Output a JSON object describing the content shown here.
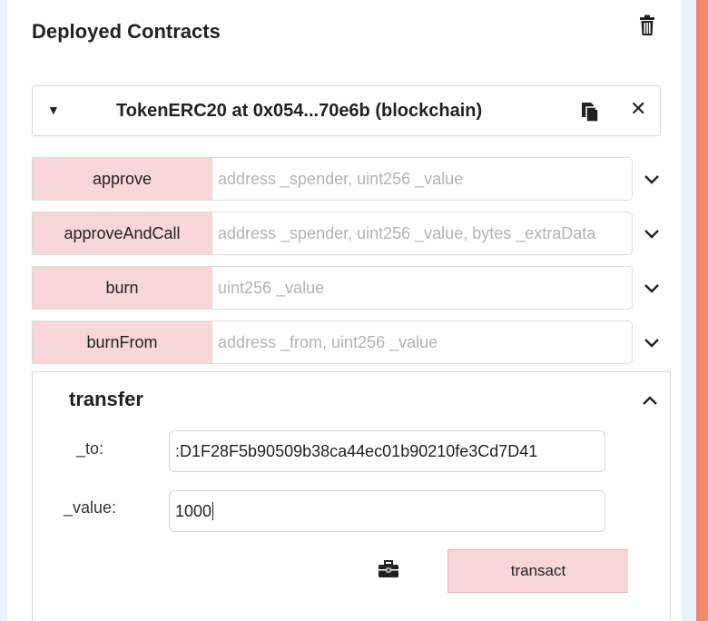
{
  "section": {
    "title": "Deployed Contracts"
  },
  "instance": {
    "title": "TokenERC20 at 0x054...70e6b (blockchain)"
  },
  "functions": [
    {
      "name": "approve",
      "placeholder": "address _spender, uint256 _value"
    },
    {
      "name": "approveAndCall",
      "placeholder": "address _spender, uint256 _value, bytes _extraData"
    },
    {
      "name": "burn",
      "placeholder": "uint256 _value"
    },
    {
      "name": "burnFrom",
      "placeholder": "address _from, uint256 _value"
    }
  ],
  "transfer": {
    "title": "transfer",
    "to_label": "_to:",
    "to_value": ":D1F28F5b90509b38ca44ec01b90210fe3Cd7D41",
    "value_label": "_value:",
    "value_value": "1000",
    "transact_label": "transact"
  },
  "icons": [
    "trash-icon",
    "caret-down-icon",
    "copy-icon",
    "close-icon",
    "chevron-down-icon",
    "chevron-up-icon",
    "briefcase-icon"
  ],
  "colors": {
    "button_bg": "#f8d7d8",
    "accent_strip": "#f2896a",
    "side_panel": "#eef0fb"
  }
}
